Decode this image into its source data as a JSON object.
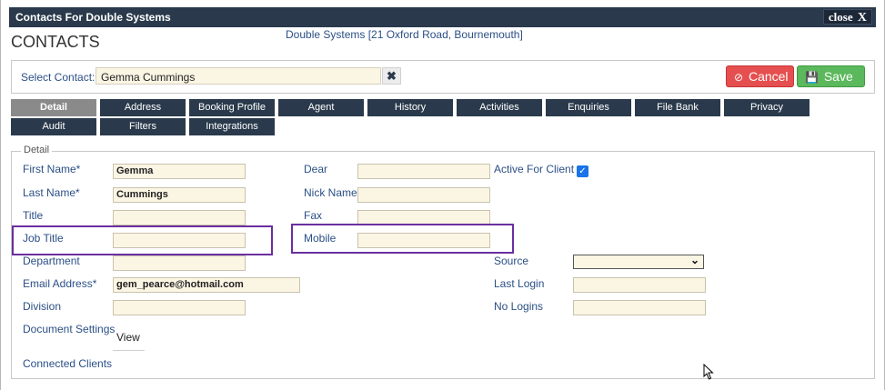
{
  "window": {
    "title": "Contacts For Double Systems",
    "close_label": "close",
    "close_x": "X"
  },
  "page": {
    "heading": "CONTACTS",
    "subheading": "Double Systems [21 Oxford Road, Bournemouth]"
  },
  "select_contact": {
    "label": "Select Contact:",
    "value": "Gemma Cummings",
    "clear_glyph": "✖"
  },
  "actions": {
    "cancel_label": "Cancel",
    "save_label": "Save"
  },
  "tabs": [
    {
      "label": "Detail",
      "active": true
    },
    {
      "label": "Address"
    },
    {
      "label": "Booking Profile"
    },
    {
      "label": "Agent"
    },
    {
      "label": "History"
    },
    {
      "label": "Activities"
    },
    {
      "label": "Enquiries"
    },
    {
      "label": "File Bank"
    },
    {
      "label": "Privacy"
    },
    {
      "label": "Audit"
    },
    {
      "label": "Filters"
    },
    {
      "label": "Integrations"
    }
  ],
  "detail": {
    "legend": "Detail",
    "first_name": {
      "label": "First Name*",
      "value": "Gemma"
    },
    "last_name": {
      "label": "Last Name*",
      "value": "Cummings"
    },
    "title": {
      "label": "Title",
      "value": ""
    },
    "job_title": {
      "label": "Job Title",
      "value": ""
    },
    "department": {
      "label": "Department",
      "value": ""
    },
    "email": {
      "label": "Email Address*",
      "value": "gem_pearce@hotmail.com"
    },
    "division": {
      "label": "Division",
      "value": ""
    },
    "document_settings": {
      "label": "Document Settings",
      "link": "View"
    },
    "connected_clients": {
      "label": "Connected Clients"
    },
    "dear": {
      "label": "Dear",
      "value": ""
    },
    "nick_name": {
      "label": "Nick Name",
      "value": ""
    },
    "fax": {
      "label": "Fax",
      "value": ""
    },
    "mobile": {
      "label": "Mobile",
      "value": ""
    },
    "active_for_client": {
      "label": "Active For Client",
      "checked": true
    },
    "source": {
      "label": "Source",
      "value": ""
    },
    "last_login": {
      "label": "Last Login",
      "value": ""
    },
    "no_logins": {
      "label": "No Logins",
      "value": ""
    }
  },
  "colors": {
    "titlebar": "#2a3a4c",
    "tab": "#2a3a4c",
    "tab_active": "#8a8a8a",
    "label": "#2b4f86",
    "field_bg": "#fbf5e4",
    "cancel": "#e54f4f",
    "save": "#5cb85c",
    "highlight": "#6b2fa0"
  }
}
